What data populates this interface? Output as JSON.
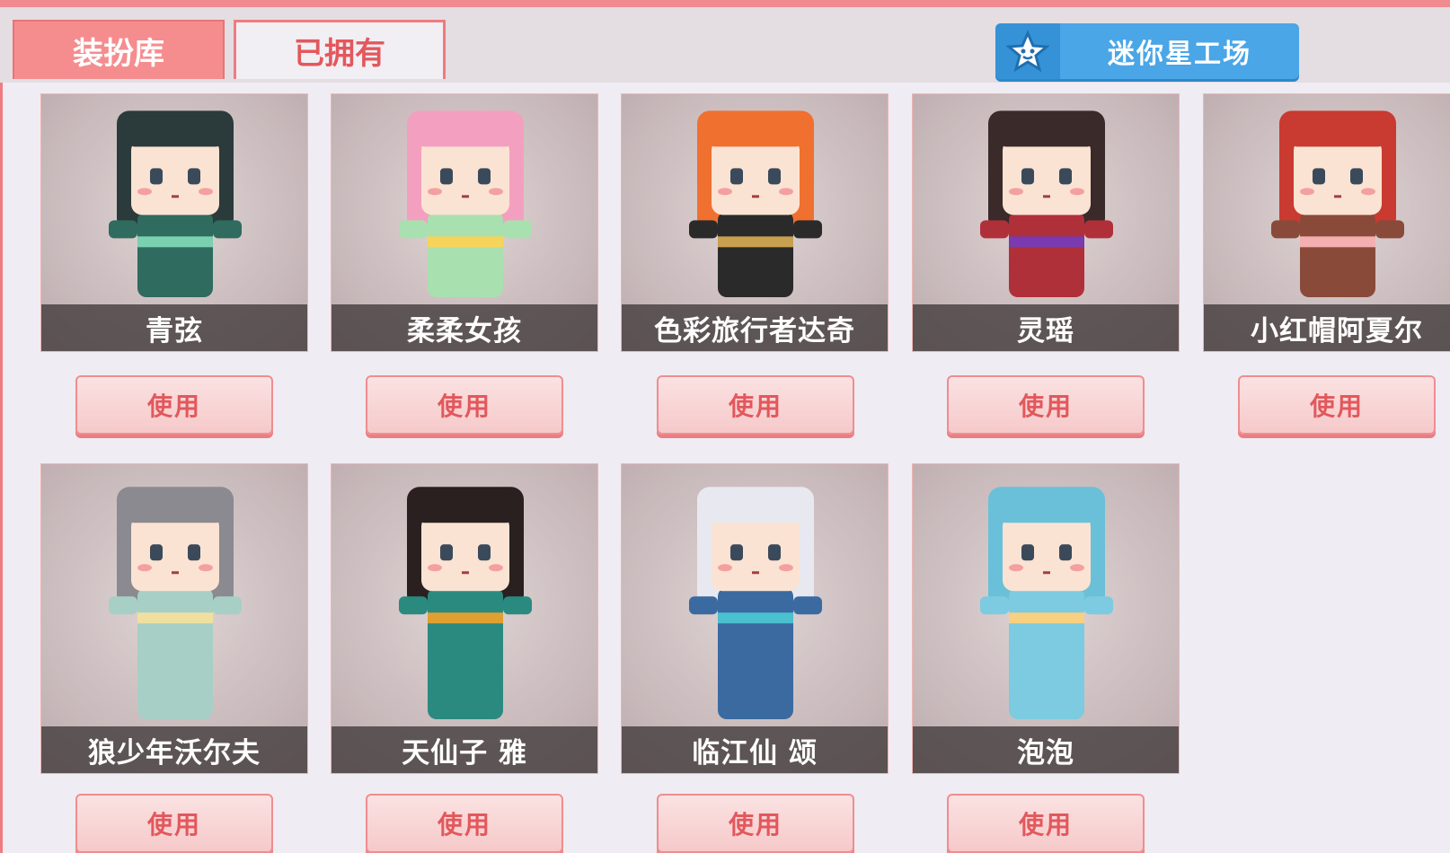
{
  "tabs": {
    "wardrobe": "装扮库",
    "owned": "已拥有"
  },
  "workshop_button": "迷你星工场",
  "skins": [
    {
      "name": "青弦",
      "button": "使用",
      "hair": "#2b3a3a",
      "outfit": "#2f6b5e",
      "accent": "#7bd0b0"
    },
    {
      "name": "柔柔女孩",
      "button": "使用",
      "hair": "#f3a0c0",
      "outfit": "#a9e0b0",
      "accent": "#f6d35a"
    },
    {
      "name": "色彩旅行者达奇",
      "button": "使用",
      "hair": "#f07030",
      "outfit": "#2a2a2a",
      "accent": "#c9a050"
    },
    {
      "name": "灵瑶",
      "button": "使用",
      "hair": "#3a2a2a",
      "outfit": "#b0303a",
      "accent": "#7a3ab0"
    },
    {
      "name": "小红帽阿夏尔",
      "button": "使用",
      "hair": "#c93a30",
      "outfit": "#8a4a3a",
      "accent": "#f4b0b0"
    },
    {
      "name": "狼少年沃尔夫",
      "button": "使用",
      "hair": "#8a8a90",
      "outfit": "#a7cfc6",
      "accent": "#f0e0a0"
    },
    {
      "name": "天仙子 雅",
      "button": "使用",
      "hair": "#2a2020",
      "outfit": "#2a8a80",
      "accent": "#e0a030"
    },
    {
      "name": "临江仙 颂",
      "button": "使用",
      "hair": "#e8e8f0",
      "outfit": "#3a6aa0",
      "accent": "#4ac0d0"
    },
    {
      "name": "泡泡",
      "button": "使用",
      "hair": "#6ac0d8",
      "outfit": "#7ccbe0",
      "accent": "#f8d080"
    }
  ]
}
